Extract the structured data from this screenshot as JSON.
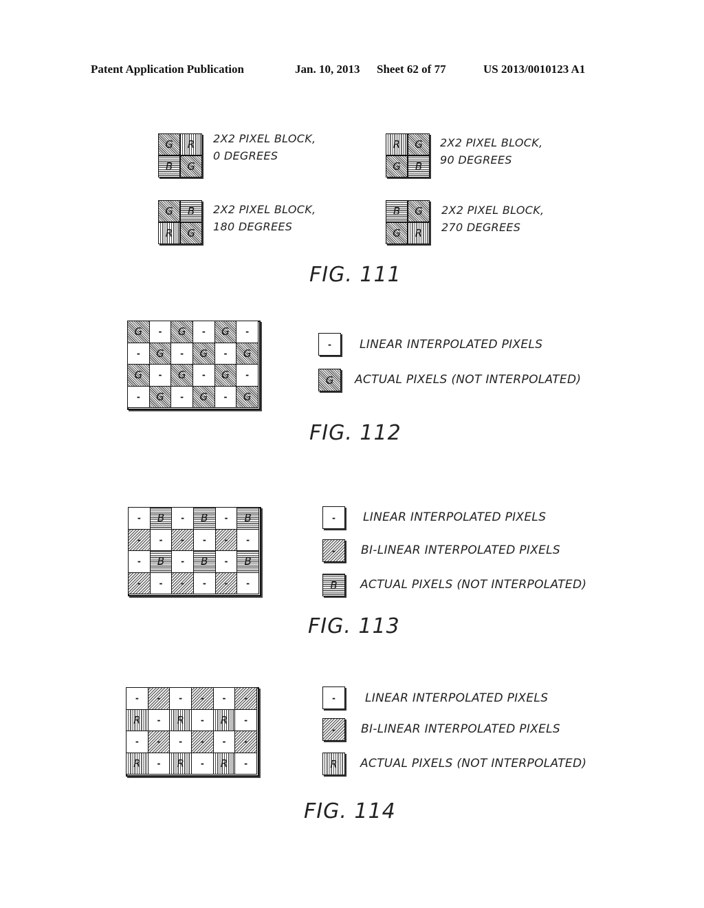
{
  "header": {
    "publication": "Patent Application Publication",
    "date": "Jan. 10, 2013",
    "sheet": "Sheet 62 of 77",
    "number": "US 2013/0010123 A1"
  },
  "fig111": {
    "caption": "FIG. 111",
    "blocks": [
      {
        "line1": "2X2 PIXEL BLOCK,",
        "line2": "0 DEGREES",
        "cells": [
          "G",
          "R",
          "B",
          "G"
        ]
      },
      {
        "line1": "2X2 PIXEL BLOCK,",
        "line2": "90 DEGREES",
        "cells": [
          "R",
          "G",
          "G",
          "B"
        ]
      },
      {
        "line1": "2X2 PIXEL BLOCK,",
        "line2": "180 DEGREES",
        "cells": [
          "G",
          "B",
          "R",
          "G"
        ]
      },
      {
        "line1": "2X2 PIXEL BLOCK,",
        "line2": "270 DEGREES",
        "cells": [
          "B",
          "G",
          "G",
          "R"
        ]
      }
    ]
  },
  "fig112": {
    "caption": "FIG. 112",
    "grid": [
      [
        "G",
        "-",
        "G",
        "-",
        "G",
        "-"
      ],
      [
        "-",
        "G",
        "-",
        "G",
        "-",
        "G"
      ],
      [
        "G",
        "-",
        "G",
        "-",
        "G",
        "-"
      ],
      [
        "-",
        "G",
        "-",
        "G",
        "-",
        "G"
      ]
    ],
    "legend": [
      {
        "symbol": "-",
        "label": "LINEAR INTERPOLATED PIXELS"
      },
      {
        "symbol": "G",
        "label": "ACTUAL PIXELS (NOT INTERPOLATED)"
      }
    ]
  },
  "fig113": {
    "caption": "FIG. 113",
    "grid": [
      [
        "-",
        "B",
        "-",
        "B",
        "-",
        "B"
      ],
      [
        "~",
        "-",
        "~",
        "-",
        "~",
        "-"
      ],
      [
        "-",
        "B",
        "-",
        "B",
        "-",
        "B"
      ],
      [
        "~",
        "-",
        "~",
        "-",
        "~",
        "-"
      ]
    ],
    "legend": [
      {
        "symbol": "-",
        "label": "LINEAR INTERPOLATED PIXELS"
      },
      {
        "symbol": "~",
        "label": "BI-LINEAR INTERPOLATED PIXELS"
      },
      {
        "symbol": "B",
        "label": "ACTUAL PIXELS (NOT INTERPOLATED)"
      }
    ]
  },
  "fig114": {
    "caption": "FIG. 114",
    "grid": [
      [
        "-",
        "~",
        "-",
        "~",
        "-",
        "~"
      ],
      [
        "R",
        "-",
        "R",
        "-",
        "R",
        "-"
      ],
      [
        "-",
        "~",
        "-",
        "~",
        "-",
        "~"
      ],
      [
        "R",
        "-",
        "R",
        "-",
        "R",
        "-"
      ]
    ],
    "legend": [
      {
        "symbol": "-",
        "label": "LINEAR INTERPOLATED PIXELS"
      },
      {
        "symbol": "~",
        "label": "BI-LINEAR INTERPOLATED PIXELS"
      },
      {
        "symbol": "R",
        "label": "ACTUAL PIXELS (NOT INTERPOLATED)"
      }
    ]
  }
}
